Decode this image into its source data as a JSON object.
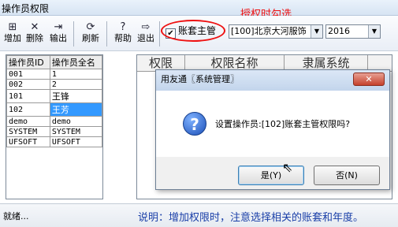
{
  "window": {
    "title": "操作员权限"
  },
  "annotation": {
    "note": "授权时勾选"
  },
  "toolbar": {
    "buttons": [
      {
        "icon": "⊞",
        "label": "增加"
      },
      {
        "icon": "✕",
        "label": "删除"
      },
      {
        "icon": "⇥",
        "label": "输出"
      },
      {
        "icon": "⟳",
        "label": "刷新"
      },
      {
        "icon": "?",
        "label": "帮助"
      },
      {
        "icon": "⇨",
        "label": "退出"
      }
    ],
    "account_master_checkbox": {
      "label": "账套主管",
      "checked": true,
      "mark": "✔"
    },
    "account_combo": {
      "value": "[100]北京大河服饰"
    },
    "year_combo": {
      "value": "2016"
    },
    "combo_arrow": "▼"
  },
  "operators": {
    "columns": [
      "操作员ID",
      "操作员全名"
    ],
    "rows": [
      [
        "001",
        "1"
      ],
      [
        "002",
        "2"
      ],
      [
        "101",
        "王锋"
      ],
      [
        "102",
        "王芳"
      ],
      [
        "demo",
        "demo"
      ],
      [
        "SYSTEM",
        "SYSTEM"
      ],
      [
        "UFSOFT",
        "UFSOFT"
      ]
    ],
    "selected_row": 3
  },
  "permissions": {
    "columns": [
      "权限",
      "权限名称",
      "隶属系统"
    ]
  },
  "dialog": {
    "title": "用友通〖系统管理〗",
    "close": "✕",
    "icon": "question-icon",
    "icon_glyph": "?",
    "message": "设置操作员:[102]账套主管权限吗?",
    "yes": "是(Y)",
    "no": "否(N)"
  },
  "cursor_glyph": "⇖",
  "status": {
    "left": "就绪...",
    "note": "说明：增加权限时，注意选择相关的账套和年度。"
  }
}
